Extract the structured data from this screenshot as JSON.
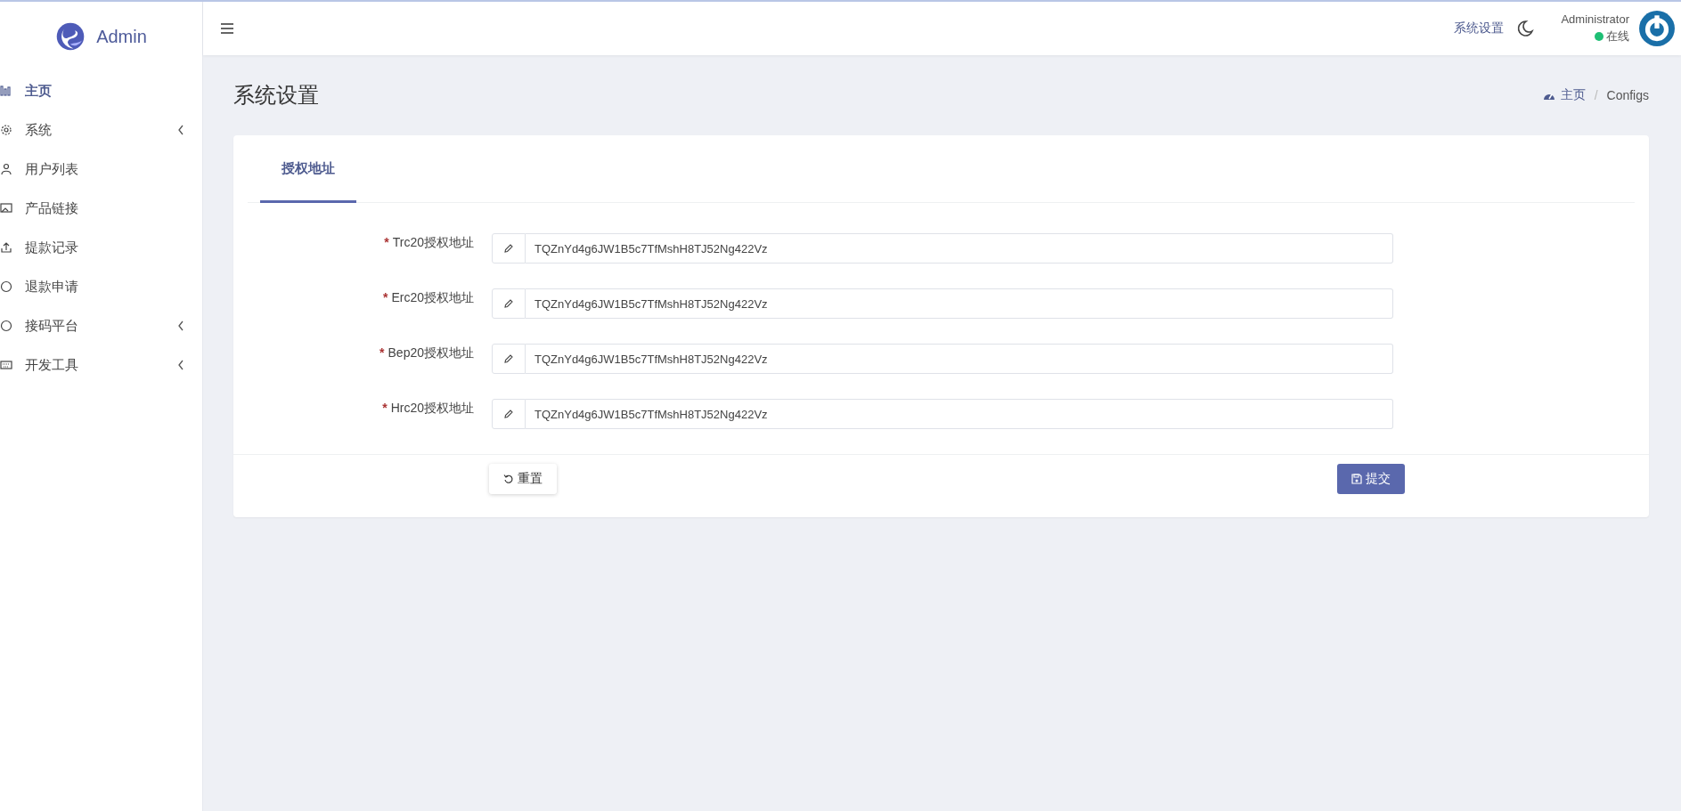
{
  "brand": {
    "name": "Admin"
  },
  "sidebar": {
    "items": [
      {
        "label": "主页",
        "kind": "chart",
        "selected": true,
        "has_children": false
      },
      {
        "label": "系统",
        "kind": "gear",
        "selected": false,
        "has_children": true
      },
      {
        "label": "用户列表",
        "kind": "user",
        "selected": false,
        "has_children": false
      },
      {
        "label": "产品链接",
        "kind": "image",
        "selected": false,
        "has_children": false
      },
      {
        "label": "提款记录",
        "kind": "upload",
        "selected": false,
        "has_children": false
      },
      {
        "label": "退款申请",
        "kind": "circle",
        "selected": false,
        "has_children": false
      },
      {
        "label": "接码平台",
        "kind": "circle",
        "selected": false,
        "has_children": true
      },
      {
        "label": "开发工具",
        "kind": "keyboard",
        "selected": false,
        "has_children": true
      }
    ]
  },
  "header": {
    "settings_link": "系统设置",
    "user": {
      "name": "Administrator",
      "status": "在线",
      "online": true
    }
  },
  "page": {
    "title": "系统设置",
    "breadcrumb": [
      {
        "label": "主页",
        "icon": true
      },
      {
        "separator": "/",
        "label": "Configs",
        "icon": false
      }
    ]
  },
  "tabs": [
    {
      "label": "授权地址",
      "selected": true
    }
  ],
  "form": {
    "fields": [
      {
        "required_mark": "*",
        "label": "Trc20授权地址",
        "value": "TQZnYd4g6JW1B5c7TfMshH8TJ52Ng422Vz"
      },
      {
        "required_mark": "*",
        "label": "Erc20授权地址",
        "value": "TQZnYd4g6JW1B5c7TfMshH8TJ52Ng422Vz"
      },
      {
        "required_mark": "*",
        "label": "Bep20授权地址",
        "value": "TQZnYd4g6JW1B5c7TfMshH8TJ52Ng422Vz"
      },
      {
        "required_mark": "*",
        "label": "Hrc20授权地址",
        "value": "TQZnYd4g6JW1B5c7TfMshH8TJ52Ng422Vz"
      }
    ],
    "reset_button": "重置",
    "submit_button": "提交"
  }
}
